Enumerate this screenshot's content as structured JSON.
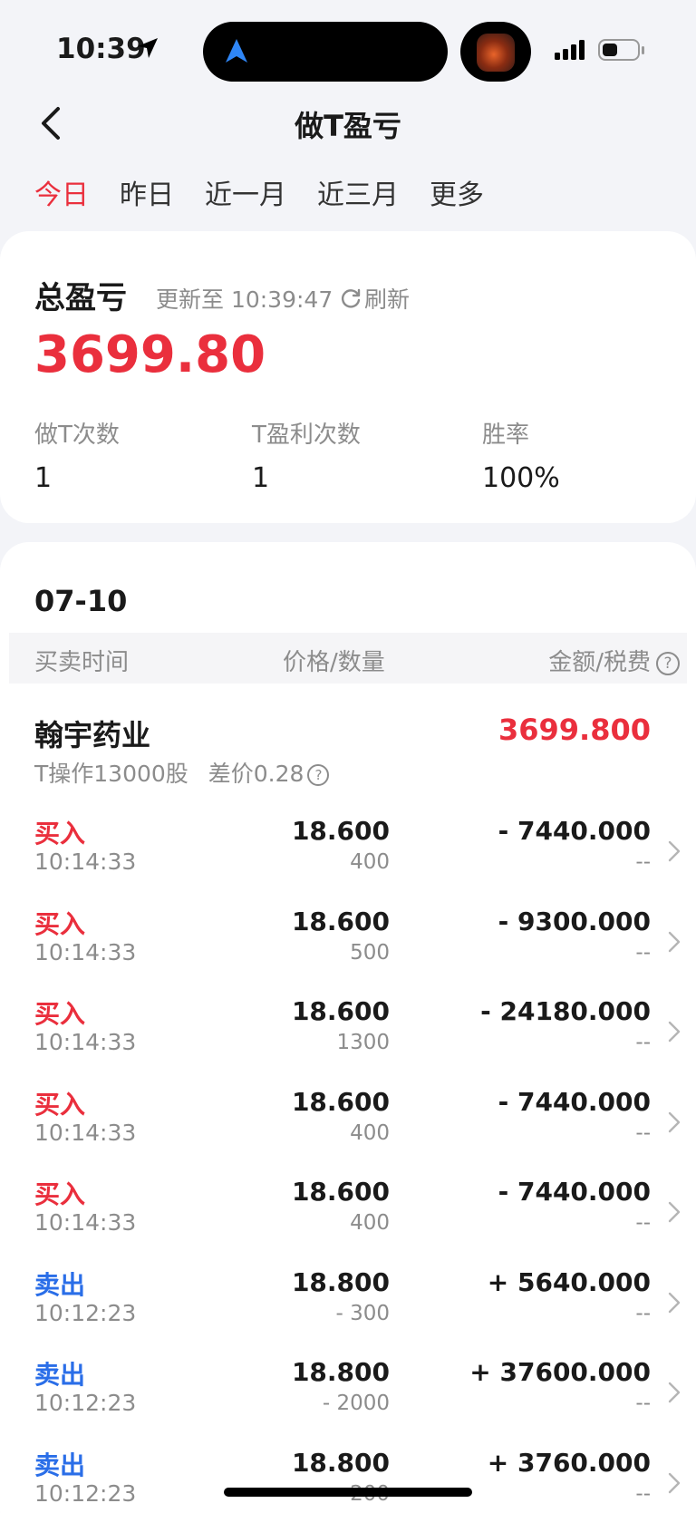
{
  "status": {
    "time": "10:39"
  },
  "nav": {
    "title": "做T盈亏"
  },
  "tabs": [
    {
      "label": "今日",
      "active": true
    },
    {
      "label": "昨日",
      "active": false
    },
    {
      "label": "近一月",
      "active": false
    },
    {
      "label": "近三月",
      "active": false
    },
    {
      "label": "更多",
      "active": false
    }
  ],
  "summary": {
    "title": "总盈亏",
    "update_text": "更新至 10:39:47",
    "refresh_label": "刷新",
    "total": "3699.80",
    "stats": [
      {
        "label": "做T次数",
        "value": "1"
      },
      {
        "label": "T盈利次数",
        "value": "1"
      },
      {
        "label": "胜率",
        "value": "100%"
      }
    ]
  },
  "detail": {
    "date": "07-10",
    "headers": {
      "time": "买卖时间",
      "price_qty": "价格/数量",
      "amount_tax": "金额/税费"
    },
    "stock": {
      "name": "翰宇药业",
      "pnl": "3699.800",
      "op": "T操作13000股",
      "diff": "差价0.28"
    },
    "rows": [
      {
        "side": "买入",
        "type": "buy",
        "time": "10:14:33",
        "price": "18.600",
        "qty": "400",
        "amount": "- 7440.000",
        "tax": "--"
      },
      {
        "side": "买入",
        "type": "buy",
        "time": "10:14:33",
        "price": "18.600",
        "qty": "500",
        "amount": "- 9300.000",
        "tax": "--"
      },
      {
        "side": "买入",
        "type": "buy",
        "time": "10:14:33",
        "price": "18.600",
        "qty": "1300",
        "amount": "- 24180.000",
        "tax": "--"
      },
      {
        "side": "买入",
        "type": "buy",
        "time": "10:14:33",
        "price": "18.600",
        "qty": "400",
        "amount": "- 7440.000",
        "tax": "--"
      },
      {
        "side": "买入",
        "type": "buy",
        "time": "10:14:33",
        "price": "18.600",
        "qty": "400",
        "amount": "- 7440.000",
        "tax": "--"
      },
      {
        "side": "卖出",
        "type": "sell",
        "time": "10:12:23",
        "price": "18.800",
        "qty": "- 300",
        "amount": "+ 5640.000",
        "tax": "--"
      },
      {
        "side": "卖出",
        "type": "sell",
        "time": "10:12:23",
        "price": "18.800",
        "qty": "- 2000",
        "amount": "+ 37600.000",
        "tax": "--"
      },
      {
        "side": "卖出",
        "type": "sell",
        "time": "10:12:23",
        "price": "18.800",
        "qty": "- 200",
        "amount": "+ 3760.000",
        "tax": "--"
      }
    ]
  },
  "colors": {
    "red": "#ea2f3d",
    "blue": "#2a6ee8",
    "gray": "#8c8c8c"
  }
}
